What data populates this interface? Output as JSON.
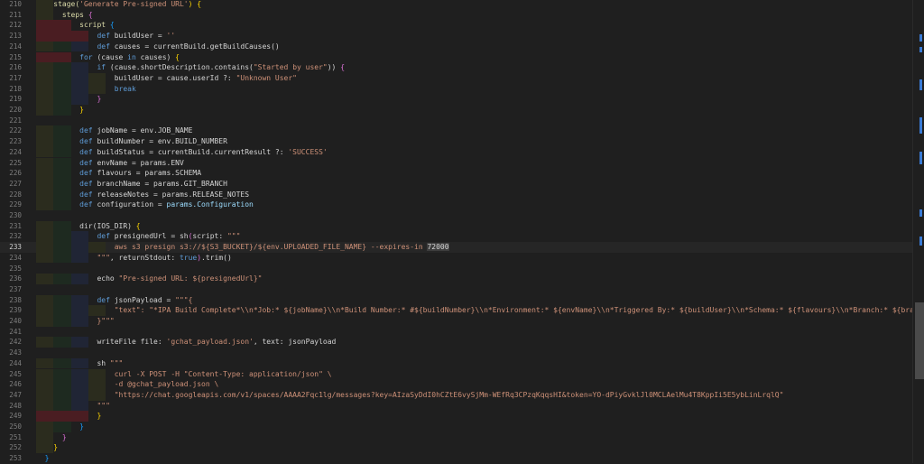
{
  "editor": {
    "current_line": 233,
    "lines": [
      {
        "n": "210",
        "t": [
          [
            "    ",
            "op"
          ],
          [
            "stage(",
            "fn"
          ],
          [
            "'Generate Pre-signed URL'",
            "str"
          ],
          [
            ") {",
            "br1"
          ]
        ]
      },
      {
        "n": "211",
        "t": [
          [
            "      ",
            "op"
          ],
          [
            "steps ",
            "fn"
          ],
          [
            "{",
            "br2"
          ]
        ]
      },
      {
        "n": "212",
        "t": [
          [
            "          ",
            "op"
          ],
          [
            "script ",
            "fn"
          ],
          [
            "{",
            "br3"
          ]
        ]
      },
      {
        "n": "213",
        "t": [
          [
            "              ",
            "op"
          ],
          [
            "def ",
            "kw"
          ],
          [
            "buildUser = ",
            "op"
          ],
          [
            "''",
            "str"
          ]
        ]
      },
      {
        "n": "214",
        "t": [
          [
            "              ",
            "op"
          ],
          [
            "def ",
            "kw"
          ],
          [
            "causes = currentBuild.getBuildCauses()",
            "op"
          ]
        ]
      },
      {
        "n": "215",
        "t": [
          [
            "          ",
            "op"
          ],
          [
            "for ",
            "kw"
          ],
          [
            "(cause ",
            "op"
          ],
          [
            "in ",
            "kw"
          ],
          [
            "causes) ",
            "op"
          ],
          [
            "{",
            "br1"
          ]
        ]
      },
      {
        "n": "216",
        "t": [
          [
            "              ",
            "op"
          ],
          [
            "if ",
            "kw"
          ],
          [
            "(cause.shortDescription.contains(",
            "op"
          ],
          [
            "\"Started by user\"",
            "str"
          ],
          [
            ")) ",
            "op"
          ],
          [
            "{",
            "br2"
          ]
        ]
      },
      {
        "n": "217",
        "t": [
          [
            "                  ",
            "op"
          ],
          [
            "buildUser = cause.userId ?: ",
            "op"
          ],
          [
            "\"Unknown User\"",
            "str"
          ]
        ]
      },
      {
        "n": "218",
        "t": [
          [
            "                  ",
            "op"
          ],
          [
            "break",
            "kw"
          ]
        ]
      },
      {
        "n": "219",
        "t": [
          [
            "              ",
            "op"
          ],
          [
            "}",
            "br2"
          ]
        ]
      },
      {
        "n": "220",
        "t": [
          [
            "          ",
            "op"
          ],
          [
            "}",
            "br1"
          ]
        ]
      },
      {
        "n": "221",
        "t": [
          [
            "",
            "op"
          ]
        ]
      },
      {
        "n": "222",
        "t": [
          [
            "          ",
            "op"
          ],
          [
            "def ",
            "kw"
          ],
          [
            "jobName = env.JOB_NAME",
            "op"
          ]
        ]
      },
      {
        "n": "223",
        "t": [
          [
            "          ",
            "op"
          ],
          [
            "def ",
            "kw"
          ],
          [
            "buildNumber = env.BUILD_NUMBER",
            "op"
          ]
        ]
      },
      {
        "n": "224",
        "t": [
          [
            "          ",
            "op"
          ],
          [
            "def ",
            "kw"
          ],
          [
            "buildStatus = currentBuild.currentResult ?: ",
            "op"
          ],
          [
            "'SUCCESS'",
            "str"
          ]
        ]
      },
      {
        "n": "225",
        "t": [
          [
            "          ",
            "op"
          ],
          [
            "def ",
            "kw"
          ],
          [
            "envName = params.ENV",
            "op"
          ]
        ]
      },
      {
        "n": "226",
        "t": [
          [
            "          ",
            "op"
          ],
          [
            "def ",
            "kw"
          ],
          [
            "flavours = params.SCHEMA",
            "op"
          ]
        ]
      },
      {
        "n": "227",
        "t": [
          [
            "          ",
            "op"
          ],
          [
            "def ",
            "kw"
          ],
          [
            "branchName = params.GIT_BRANCH",
            "op"
          ]
        ]
      },
      {
        "n": "228",
        "t": [
          [
            "          ",
            "op"
          ],
          [
            "def ",
            "kw"
          ],
          [
            "releaseNotes = params.RELEASE_NOTES",
            "op"
          ]
        ]
      },
      {
        "n": "229",
        "t": [
          [
            "          ",
            "op"
          ],
          [
            "def ",
            "kw"
          ],
          [
            "configuration = ",
            "op"
          ],
          [
            "params.Configuration",
            "var"
          ]
        ]
      },
      {
        "n": "230",
        "t": [
          [
            "",
            "op"
          ]
        ]
      },
      {
        "n": "231",
        "t": [
          [
            "          ",
            "op"
          ],
          [
            "dir(IOS_DIR) ",
            "op"
          ],
          [
            "{",
            "br1"
          ]
        ]
      },
      {
        "n": "232",
        "t": [
          [
            "              ",
            "op"
          ],
          [
            "def ",
            "kw"
          ],
          [
            "presignedUrl = sh",
            "op"
          ],
          [
            "(",
            "br2"
          ],
          [
            "script: ",
            "op"
          ],
          [
            "\"\"\"",
            "str"
          ]
        ]
      },
      {
        "n": "233",
        "t": [
          [
            "                  ",
            "op"
          ],
          [
            "aws s3 presign s3://${S3_BUCKET}/${env.UPLOADED_FILE_NAME} --expires-in ",
            "str"
          ],
          [
            "72000",
            "sel"
          ]
        ]
      },
      {
        "n": "234",
        "t": [
          [
            "              ",
            "op"
          ],
          [
            "\"\"\"",
            "str"
          ],
          [
            ", returnStdout: ",
            "op"
          ],
          [
            "true",
            "kw"
          ],
          [
            ")",
            "br2"
          ],
          [
            ".trim()",
            "op"
          ]
        ]
      },
      {
        "n": "235",
        "t": [
          [
            "",
            "op"
          ]
        ]
      },
      {
        "n": "236",
        "t": [
          [
            "              ",
            "op"
          ],
          [
            "echo ",
            "op"
          ],
          [
            "\"Pre-signed URL: ${presignedUrl}\"",
            "str"
          ]
        ]
      },
      {
        "n": "237",
        "t": [
          [
            "",
            "op"
          ]
        ]
      },
      {
        "n": "238",
        "t": [
          [
            "              ",
            "op"
          ],
          [
            "def ",
            "kw"
          ],
          [
            "jsonPayload = ",
            "op"
          ],
          [
            "\"\"\"{",
            "str"
          ]
        ]
      },
      {
        "n": "239",
        "t": [
          [
            "                  ",
            "op"
          ],
          [
            "\"text\": \"*IPA Build Complete*\\\\n*Job:* ${jobName}\\\\n*Build Number:* #${buildNumber}\\\\n*Environment:* ${envName}\\\\n*Triggered By:* ${buildUser}\\\\n*Schema:* ${flavours}\\\\n*Branch:* ${branchName}\\\\n",
            "str"
          ]
        ]
      },
      {
        "n": "240",
        "t": [
          [
            "              ",
            "op"
          ],
          [
            "}\"\"\"",
            "str"
          ]
        ]
      },
      {
        "n": "241",
        "t": [
          [
            "",
            "op"
          ]
        ]
      },
      {
        "n": "242",
        "t": [
          [
            "              ",
            "op"
          ],
          [
            "writeFile file: ",
            "op"
          ],
          [
            "'gchat_payload.json'",
            "str"
          ],
          [
            ", text: jsonPayload",
            "op"
          ]
        ]
      },
      {
        "n": "243",
        "t": [
          [
            "",
            "op"
          ]
        ]
      },
      {
        "n": "244",
        "t": [
          [
            "              ",
            "op"
          ],
          [
            "sh ",
            "op"
          ],
          [
            "\"\"\"",
            "str"
          ]
        ]
      },
      {
        "n": "245",
        "t": [
          [
            "                  ",
            "op"
          ],
          [
            "curl -X POST -H \"Content-Type: application/json\" \\",
            "str"
          ]
        ]
      },
      {
        "n": "246",
        "t": [
          [
            "                  ",
            "op"
          ],
          [
            "-d @gchat_payload.json \\",
            "str"
          ]
        ]
      },
      {
        "n": "247",
        "t": [
          [
            "                  ",
            "op"
          ],
          [
            "\"https://chat.googleapis.com/v1/spaces/AAAA2Fqc1lg/messages?key=AIzaSyDdI0hCZtE6vySjMm-WEfRq3CPzqKqqsHI&token=YO-dPiyGvklJl0MCLAelMu4T8KppIi5E5ybLinLrqlQ\"",
            "str"
          ]
        ]
      },
      {
        "n": "248",
        "t": [
          [
            "              ",
            "op"
          ],
          [
            "\"\"\"",
            "str"
          ]
        ]
      },
      {
        "n": "249",
        "t": [
          [
            "              ",
            "op"
          ],
          [
            "}",
            "br1"
          ]
        ]
      },
      {
        "n": "250",
        "t": [
          [
            "          ",
            "op"
          ],
          [
            "}",
            "br3"
          ]
        ]
      },
      {
        "n": "251",
        "t": [
          [
            "      ",
            "op"
          ],
          [
            "}",
            "br2"
          ]
        ]
      },
      {
        "n": "252",
        "t": [
          [
            "    ",
            "op"
          ],
          [
            "}",
            "br1"
          ]
        ]
      },
      {
        "n": "253",
        "t": [
          [
            "  ",
            "op"
          ],
          [
            "}",
            "br3"
          ]
        ]
      }
    ]
  },
  "colors": {
    "background": "#1f1f1f",
    "keyword": "#5e9bd6",
    "string": "#ce9178",
    "selection": "#3d3d3d",
    "indent_error": "#4a1d22"
  }
}
